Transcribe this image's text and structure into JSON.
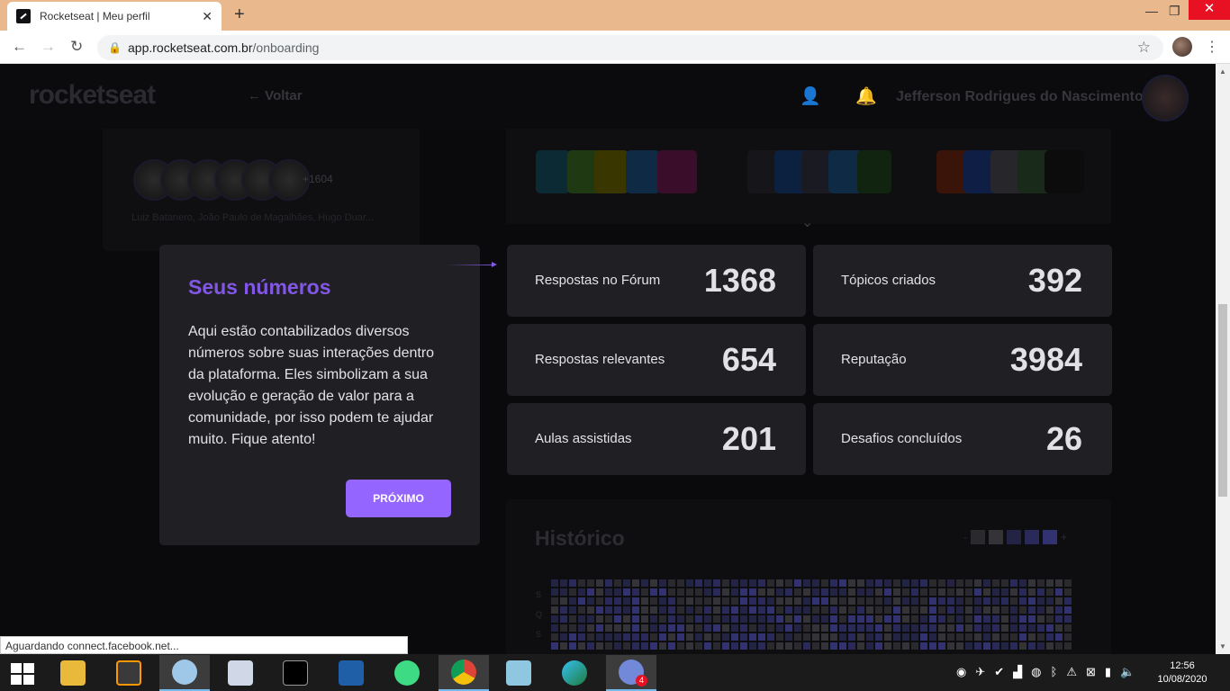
{
  "browser": {
    "tab_title": "Rocketseat | Meu perfil",
    "tab_close": "✕",
    "new_tab": "+",
    "url_host": "app.rocketseat.com.br",
    "url_path": "/onboarding",
    "status_text": "Aguardando connect.facebook.net..."
  },
  "header": {
    "logo": "rocketseat",
    "back_label": "Voltar",
    "username": "Jefferson Rodrigues do Nascimento"
  },
  "background": {
    "avatars_more": "+1604",
    "avatar_names": "Luiz Batanero, João Paulo de Magalhães, Hugo Duar...",
    "history_title": "Histórico",
    "legend_minus": "-",
    "legend_plus": "+",
    "legend_colors": [
      "#2a2a2e",
      "#333338",
      "#232344",
      "#2a2a5a",
      "#323270"
    ],
    "heat_days": [
      "S",
      "Q",
      "S"
    ]
  },
  "tour": {
    "title": "Seus números",
    "text": "Aqui estão contabilizados diversos números sobre suas interações dentro da plataforma. Eles simbolizam a sua evolução e geração de valor para a comunidade, por isso podem te ajudar muito. Fique atento!",
    "next_label": "PRÓXIMO"
  },
  "stats": [
    {
      "label": "Respostas no Fórum",
      "value": "1368"
    },
    {
      "label": "Tópicos criados",
      "value": "392"
    },
    {
      "label": "Respostas relevantes",
      "value": "654"
    },
    {
      "label": "Reputação",
      "value": "3984"
    },
    {
      "label": "Aulas assistidas",
      "value": "201"
    },
    {
      "label": "Desafios concluídos",
      "value": "26"
    }
  ],
  "taskbar": {
    "time": "12:56",
    "date": "10/08/2020",
    "discord_badge": "4"
  },
  "colors": {
    "accent": "#8257e5",
    "button": "#9466ff",
    "card": "#202024"
  }
}
